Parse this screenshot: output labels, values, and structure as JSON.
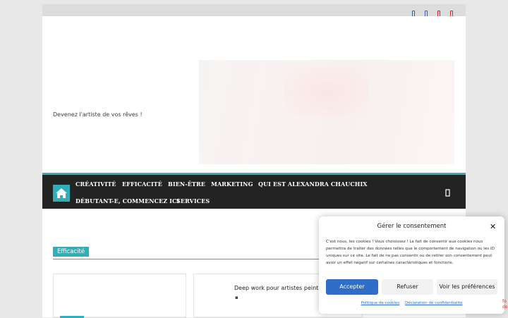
{
  "social": {
    "icons": [
      {
        "name": "facebook-icon",
        "color": "#3b5998"
      },
      {
        "name": "twitter-icon",
        "color": "#3b5fc0"
      },
      {
        "name": "pinterest-icon",
        "color": "#c8232c"
      },
      {
        "name": "youtube-icon",
        "color": "#e02b2b"
      }
    ]
  },
  "header": {
    "tagline": "Devenez l'artiste de vos rêves !"
  },
  "nav": {
    "items": [
      "CRÉATIVITÉ",
      "EFFICACITÉ",
      "BIEN-ÊTRE",
      "MARKETING",
      "QUI EST ALEXANDRA CHAUCHIX",
      "DÉBUTANT-E, COMMENCEZ ICI",
      "SERVICES"
    ]
  },
  "content": {
    "section_title": "Efficacité",
    "card_title": "Deep work pour artistes peintres"
  },
  "consent": {
    "title": "Gérer le consentement",
    "text": "C'est nous, les cookies ! Vous choisissez ! Le fait de consentir aux cookies nous permettra de traiter des données telles que le comportement de navigation ou les ID uniques sur ce site. Le fait de ne pas consentir ou de retirer son consentement peut avoir un effet négatif sur certaines caractéristiques et fonctions.",
    "accept": "Accepter",
    "refuse": "Refuser",
    "preferences": "Voir les préférences",
    "link_cookies": "Politique de cookies",
    "link_privacy": "Déclaration de confidentialité"
  },
  "colors": {
    "accent": "#30afb8",
    "nav_bg": "#232323",
    "button_blue": "#2e6ec8"
  }
}
